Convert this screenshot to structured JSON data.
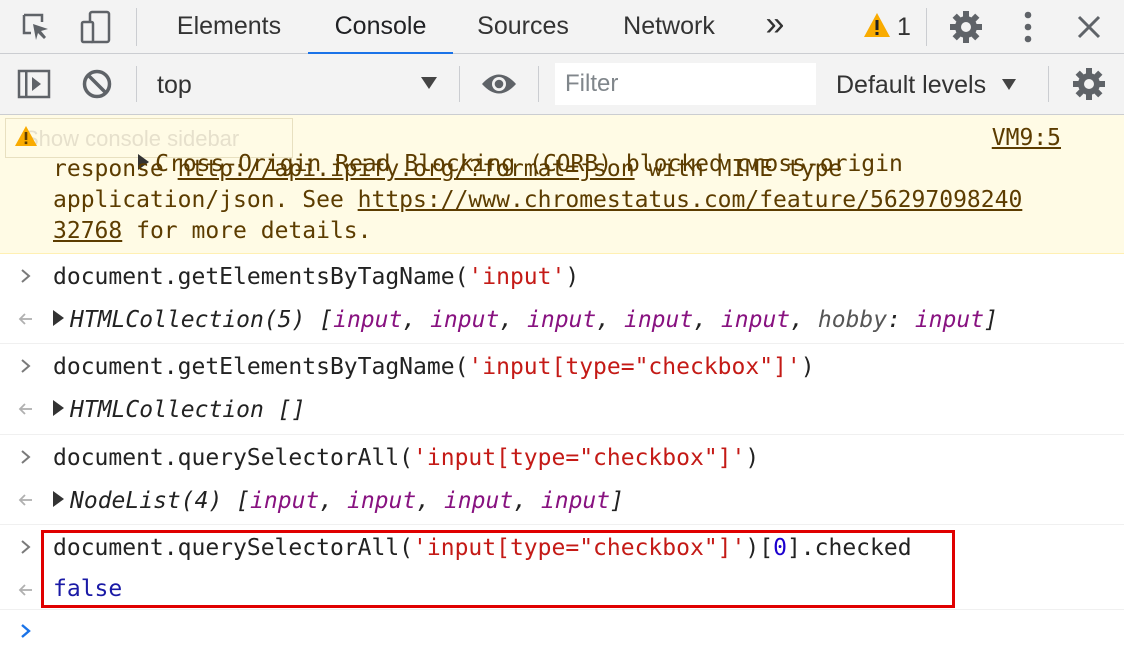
{
  "tabs": {
    "items": [
      {
        "label": "Elements"
      },
      {
        "label": "Console"
      },
      {
        "label": "Sources"
      },
      {
        "label": "Network"
      }
    ],
    "more_label": "»",
    "warning_count": "1"
  },
  "toolbar": {
    "context": "top",
    "filter_placeholder": "Filter",
    "levels_label": "Default levels"
  },
  "warning": {
    "tooltip": "Show console sidebar",
    "text1": "Cross-Origin Read Blocking (CORB) blocked cross-origin",
    "text2a": "response ",
    "link1": "http://api.ipify.org/?format=json",
    "text2b": " with MIME type",
    "text3a": "application/json. See ",
    "link2a": "https://www.chromestatus.com/feature/56297098240",
    "link2b": "32768",
    "text4b": " for more details.",
    "source": "VM9:5"
  },
  "entries": [
    {
      "cmd_pre": "document.getElementsByTagName(",
      "cmd_str": "'input'",
      "cmd_post": ")",
      "result_type": "HTMLCollection(5)",
      "result_items": [
        "input",
        "input",
        "input",
        "input",
        "input"
      ],
      "result_named_key": "hobby",
      "result_named_val": "input"
    },
    {
      "cmd_pre": "document.getElementsByTagName(",
      "cmd_str": "'input[type=\"checkbox\"]'",
      "cmd_post": ")",
      "result_type": "HTMLCollection",
      "result_empty": "[]"
    },
    {
      "cmd_pre": "document.querySelectorAll(",
      "cmd_str": "'input[type=\"checkbox\"]'",
      "cmd_post": ")",
      "result_type": "NodeList(4)",
      "result_items": [
        "input",
        "input",
        "input",
        "input"
      ]
    },
    {
      "cmd_pre": "document.querySelectorAll(",
      "cmd_str": "'input[type=\"checkbox\"]'",
      "cmd_mid": ")[",
      "cmd_num": "0",
      "cmd_post": "].checked",
      "result_value": "false"
    }
  ],
  "colors": {
    "accent": "#1a73e8",
    "warning_bg": "#fffbe5",
    "warning_text": "#5c3c00",
    "string": "#c41a16",
    "element": "#881280",
    "highlight_box": "#e00000"
  }
}
